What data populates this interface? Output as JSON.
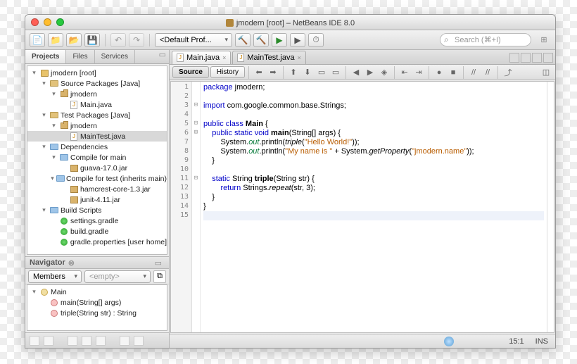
{
  "window": {
    "title": "jmodern [root] – NetBeans IDE 8.0"
  },
  "toolbar": {
    "config_label": "<Default Prof...",
    "search_placeholder": "Search (⌘+I)"
  },
  "projects_panel": {
    "tabs": [
      "Projects",
      "Files",
      "Services"
    ],
    "active_tab": 0
  },
  "tree": [
    {
      "d": 0,
      "t": "▾",
      "i": "root",
      "l": "jmodern [root]"
    },
    {
      "d": 1,
      "t": "▾",
      "i": "folder",
      "l": "Source Packages [Java]"
    },
    {
      "d": 2,
      "t": "▾",
      "i": "pkg",
      "l": "jmodern"
    },
    {
      "d": 3,
      "t": "",
      "i": "java",
      "l": "Main.java"
    },
    {
      "d": 1,
      "t": "▾",
      "i": "folder",
      "l": "Test Packages [Java]"
    },
    {
      "d": 2,
      "t": "▾",
      "i": "pkg",
      "l": "jmodern"
    },
    {
      "d": 3,
      "t": "",
      "i": "java",
      "l": "MainTest.java",
      "sel": true
    },
    {
      "d": 1,
      "t": "▾",
      "i": "folder-blue",
      "l": "Dependencies"
    },
    {
      "d": 2,
      "t": "▾",
      "i": "folder-blue",
      "l": "Compile for main"
    },
    {
      "d": 3,
      "t": "",
      "i": "jar",
      "l": "guava-17.0.jar"
    },
    {
      "d": 2,
      "t": "▾",
      "i": "folder-blue",
      "l": "Compile for test (inherits main)"
    },
    {
      "d": 3,
      "t": "",
      "i": "jar",
      "l": "hamcrest-core-1.3.jar"
    },
    {
      "d": 3,
      "t": "",
      "i": "jar",
      "l": "junit-4.11.jar"
    },
    {
      "d": 1,
      "t": "▾",
      "i": "folder-blue",
      "l": "Build Scripts"
    },
    {
      "d": 2,
      "t": "",
      "i": "grad",
      "l": "settings.gradle"
    },
    {
      "d": 2,
      "t": "",
      "i": "grad",
      "l": "build.gradle"
    },
    {
      "d": 2,
      "t": "",
      "i": "grad",
      "l": "gradle.properties [user home]"
    }
  ],
  "navigator": {
    "title": "Navigator",
    "view": "Members",
    "filter": "<empty>",
    "items": [
      {
        "d": 0,
        "t": "▾",
        "i": "cls",
        "l": "Main"
      },
      {
        "d": 1,
        "t": "",
        "i": "meth",
        "l": "main(String[] args)"
      },
      {
        "d": 1,
        "t": "",
        "i": "meth",
        "l": "triple(String str) : String"
      }
    ]
  },
  "editor": {
    "tabs": [
      {
        "label": "Main.java",
        "active": true
      },
      {
        "label": "MainTest.java",
        "active": false
      }
    ],
    "views": {
      "source": "Source",
      "history": "History"
    },
    "line_count": 15
  },
  "code": {
    "l1": "package",
    "l1b": " jmodern;",
    "l3": "import",
    "l3b": " com.google.common.base.Strings;",
    "l5": "public class ",
    "l5b": "Main",
    "l5c": " {",
    "l6": "    public static void ",
    "l6b": "main",
    "l6c": "(String[] args) {",
    "l7a": "        System.",
    "l7b": "out",
    "l7c": ".println(",
    "l7d": "triple",
    "l7e": "(",
    "l7f": "\"Hello World!\"",
    "l7g": "));",
    "l8a": "        System.",
    "l8b": "out",
    "l8c": ".println(",
    "l8d": "\"My name is \"",
    "l8e": " + System.",
    "l8f": "getProperty",
    "l8g": "(",
    "l8h": "\"jmodern.name\"",
    "l8i": "));",
    "l9": "    }",
    "l11": "    static",
    "l11b": " String ",
    "l11c": "triple",
    "l11d": "(String str) {",
    "l12": "        return",
    "l12b": " Strings.",
    "l12c": "repeat",
    "l12d": "(str, 3);",
    "l13": "    }",
    "l14": "}"
  },
  "status": {
    "cursor": "15:1",
    "mode": "INS"
  }
}
